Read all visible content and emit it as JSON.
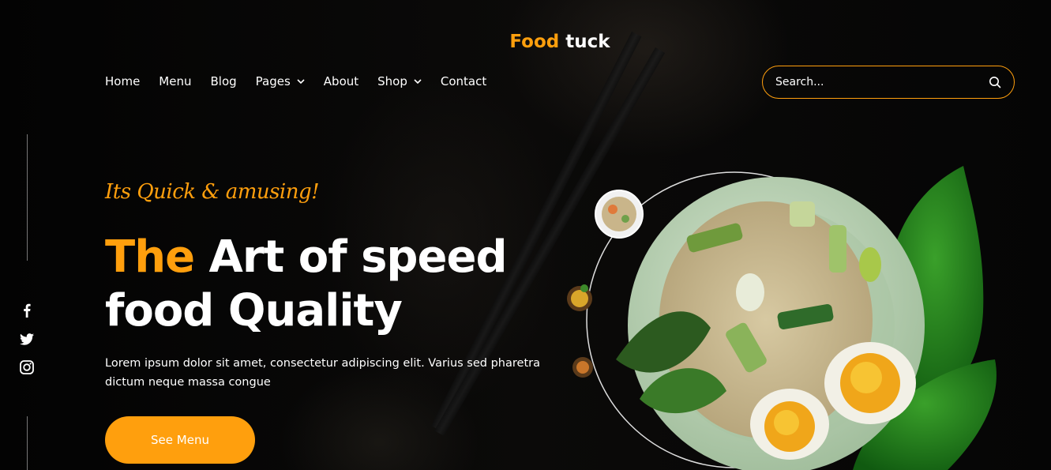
{
  "brand": {
    "name_accent": "Food",
    "name_rest": " tuck",
    "accent_color": "#FF9F0D"
  },
  "nav": {
    "items": [
      {
        "label": "Home",
        "dropdown": false
      },
      {
        "label": "Menu",
        "dropdown": false
      },
      {
        "label": "Blog",
        "dropdown": false
      },
      {
        "label": "Pages",
        "dropdown": true
      },
      {
        "label": "About",
        "dropdown": false
      },
      {
        "label": "Shop",
        "dropdown": true
      },
      {
        "label": "Contact",
        "dropdown": false
      }
    ]
  },
  "search": {
    "placeholder": "Search...",
    "icon": "search-icon"
  },
  "social": {
    "icons": [
      "facebook-icon",
      "twitter-icon",
      "instagram-icon"
    ]
  },
  "hero": {
    "tagline": "Its Quick & amusing!",
    "headline_accent": "The",
    "headline_line1_rest": " Art of speed",
    "headline_line2": "food Quality",
    "description": "Lorem ipsum dolor sit amet, consectetur adipiscing elit. Varius sed pharetra dictum neque massa congue",
    "cta_label": "See Menu"
  }
}
